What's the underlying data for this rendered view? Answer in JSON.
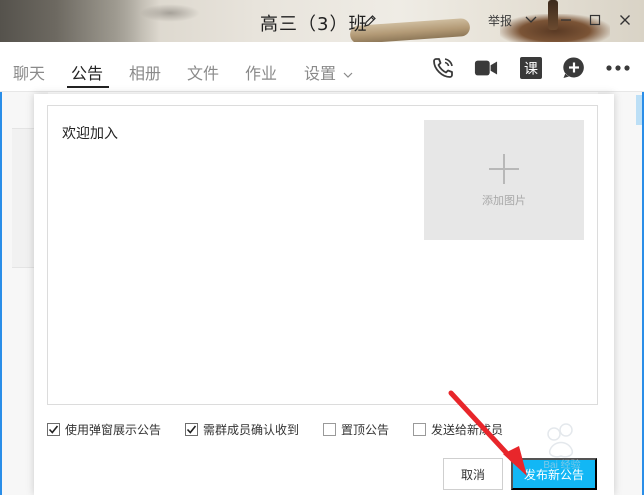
{
  "window": {
    "title": "高三（3）班",
    "report_label": "举报"
  },
  "tabs": [
    {
      "label": "聊天",
      "active": false
    },
    {
      "label": "公告",
      "active": true
    },
    {
      "label": "相册",
      "active": false
    },
    {
      "label": "文件",
      "active": false
    },
    {
      "label": "作业",
      "active": false
    },
    {
      "label": "设置",
      "active": false
    }
  ],
  "toolbar": {
    "icons": [
      "phone-icon",
      "video-icon",
      "lesson-icon",
      "help-icon",
      "more-icon"
    ],
    "lesson_label": "课"
  },
  "announcement": {
    "text": "欢迎加入",
    "add_image_label": "添加图片"
  },
  "options": [
    {
      "label": "使用弹窗展示公告",
      "checked": true
    },
    {
      "label": "需群成员确认收到",
      "checked": true
    },
    {
      "label": "置顶公告",
      "checked": false
    },
    {
      "label": "发送给新成员",
      "checked": false
    }
  ],
  "buttons": {
    "cancel": "取消",
    "publish": "发布新公告"
  },
  "watermark_text": "Bai 经验",
  "colors": {
    "accent": "#12b7f5",
    "arrow": "#e8262b",
    "text": "#222222",
    "muted": "#8a8a8a"
  }
}
